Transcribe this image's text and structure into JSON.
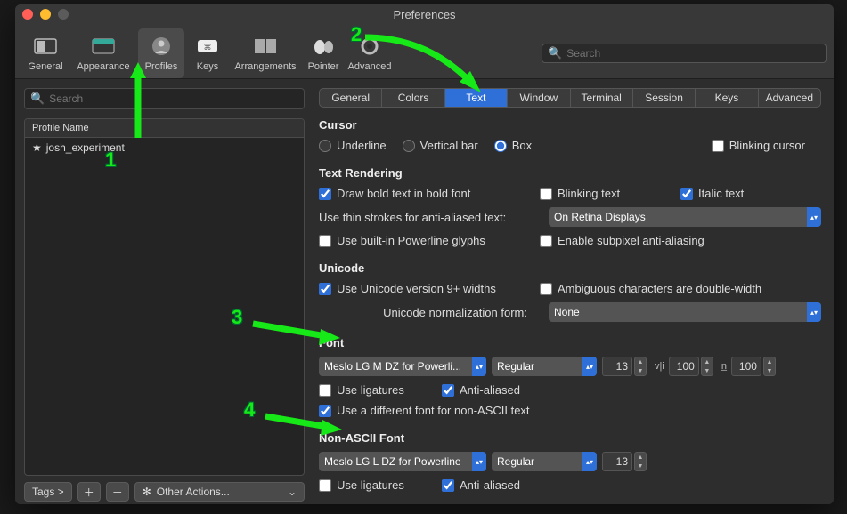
{
  "window": {
    "title": "Preferences"
  },
  "toolbar": {
    "items": [
      {
        "label": "General"
      },
      {
        "label": "Appearance"
      },
      {
        "label": "Profiles"
      },
      {
        "label": "Keys"
      },
      {
        "label": "Arrangements"
      },
      {
        "label": "Pointer"
      },
      {
        "label": "Advanced"
      }
    ],
    "search_placeholder": "Search"
  },
  "sidebar": {
    "search_placeholder": "Search",
    "header": "Profile Name",
    "profiles": [
      {
        "name": "josh_experiment",
        "starred": true
      }
    ],
    "tags_label": "Tags >",
    "other_label": "Other Actions..."
  },
  "tabs": [
    "General",
    "Colors",
    "Text",
    "Window",
    "Terminal",
    "Session",
    "Keys",
    "Advanced"
  ],
  "active_tab": "Text",
  "cursor": {
    "heading": "Cursor",
    "underline": "Underline",
    "vertical": "Vertical bar",
    "box": "Box",
    "blinking": "Blinking cursor"
  },
  "text_rendering": {
    "heading": "Text Rendering",
    "bold": "Draw bold text in bold font",
    "blinking_text": "Blinking text",
    "italic": "Italic text",
    "thin_label": "Use thin strokes for anti-aliased text:",
    "thin_value": "On Retina Displays",
    "powerline": "Use built-in Powerline glyphs",
    "subpixel": "Enable subpixel anti-aliasing"
  },
  "unicode": {
    "heading": "Unicode",
    "v9": "Use Unicode version 9+ widths",
    "ambiguous": "Ambiguous characters are double-width",
    "norm_label": "Unicode normalization form:",
    "norm_value": "None"
  },
  "font": {
    "heading": "Font",
    "family": "Meslo LG M DZ for Powerli...",
    "weight": "Regular",
    "size": "13",
    "hspacing": "100",
    "vspacing": "100",
    "ligatures": "Use ligatures",
    "aa": "Anti-aliased",
    "diff": "Use a different font for non-ASCII text"
  },
  "nonascii": {
    "heading": "Non-ASCII Font",
    "family": "Meslo LG L DZ for Powerline",
    "weight": "Regular",
    "size": "13",
    "ligatures": "Use ligatures",
    "aa": "Anti-aliased"
  },
  "annotations": {
    "n1": "1",
    "n2": "2",
    "n3": "3",
    "n4": "4"
  }
}
